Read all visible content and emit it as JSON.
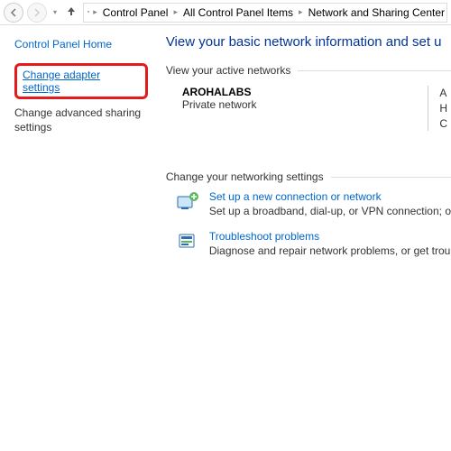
{
  "breadcrumb": {
    "items": [
      "Control Panel",
      "All Control Panel Items",
      "Network and Sharing Center"
    ]
  },
  "sidebar": {
    "home": "Control Panel Home",
    "change_adapter": "Change adapter settings",
    "change_sharing": "Change advanced sharing settings"
  },
  "main": {
    "heading": "View your basic network information and set u",
    "active_label": "View your active networks",
    "network": {
      "name": "AROHALABS",
      "type": "Private network",
      "right1": "A",
      "right2": "H",
      "right3": "C"
    },
    "change_label": "Change your networking settings",
    "options": [
      {
        "title": "Set up a new connection or network",
        "desc": "Set up a broadband, dial-up, or VPN connection; o"
      },
      {
        "title": "Troubleshoot problems",
        "desc": "Diagnose and repair network problems, or get trou"
      }
    ]
  }
}
